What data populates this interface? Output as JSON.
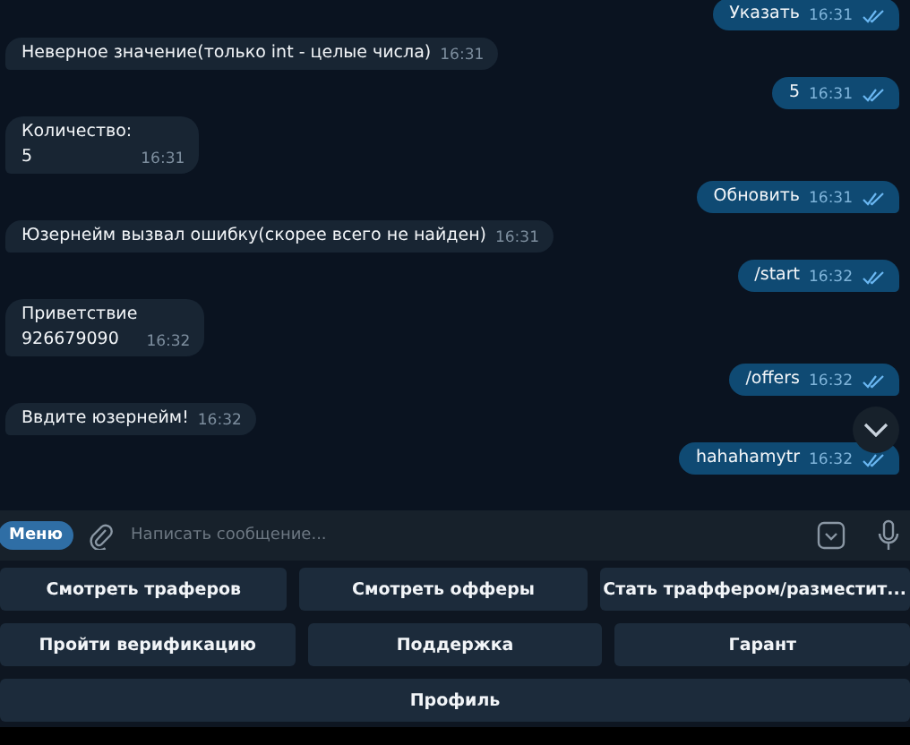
{
  "messages": [
    {
      "kind": "out",
      "text": "Указать",
      "time": "16:31",
      "read": true
    },
    {
      "kind": "in",
      "text": "Неверное значение(только int - целые числа)",
      "time": "16:31"
    },
    {
      "kind": "out",
      "text": "5",
      "time": "16:31",
      "read": true
    },
    {
      "kind": "in",
      "text": "Количество:\n5",
      "time": "16:31"
    },
    {
      "kind": "out",
      "text": "Обновить",
      "time": "16:31",
      "read": true
    },
    {
      "kind": "in",
      "text": "Юзернейм вызвал ошибку(скорее всего не найден)",
      "time": "16:31"
    },
    {
      "kind": "out",
      "text": "/start",
      "time": "16:32",
      "read": true
    },
    {
      "kind": "in",
      "text": "Приветствие\n926679090",
      "time": "16:32"
    },
    {
      "kind": "out",
      "text": "/offers",
      "time": "16:32",
      "read": true
    },
    {
      "kind": "in",
      "text": "Ввдите юзернейм!",
      "time": "16:32"
    },
    {
      "kind": "out",
      "text": "hahahamytr",
      "time": "16:32",
      "read": true
    }
  ],
  "composer": {
    "menu_button": "Меню",
    "placeholder": "Написать сообщение..."
  },
  "keyboard": [
    [
      "Смотреть траферов",
      "Смотреть офферы",
      "Стать траффером/разместит..."
    ],
    [
      "Пройти верификацию",
      "Поддержка",
      "Гарант"
    ],
    [
      "Профиль"
    ]
  ]
}
